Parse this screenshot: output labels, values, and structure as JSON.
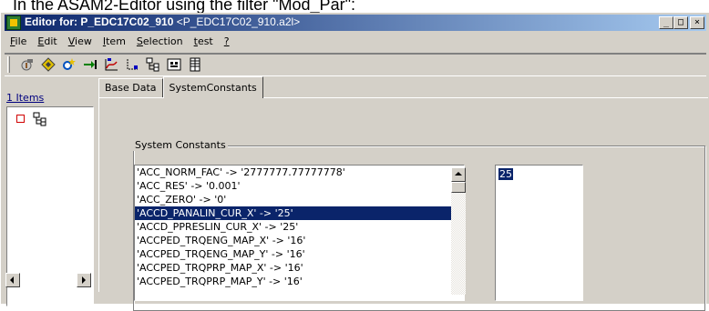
{
  "caption": "In the ASAM2-Editor using the filter \"Mod_Par\":",
  "window": {
    "title_main": "Editor for: P_EDC17C02_910",
    "title_suffix": "<P_EDC17C02_910.a2l>",
    "controls": {
      "minimize": "_",
      "maximize": "□",
      "close": "×"
    }
  },
  "menu": [
    {
      "ul": "F",
      "rest": "ile"
    },
    {
      "ul": "E",
      "rest": "dit"
    },
    {
      "ul": "V",
      "rest": "iew"
    },
    {
      "ul": "I",
      "rest": "tem"
    },
    {
      "ul": "S",
      "rest": "election"
    },
    {
      "ul": "t",
      "rest": "est"
    },
    {
      "ul": "?",
      "rest": ""
    }
  ],
  "toolbar": {
    "icons": [
      "hammer-icon",
      "diamond-tool-icon",
      "gear-star-icon",
      "arrow-bar-icon",
      "curve-chart-icon",
      "axis-icon",
      "tree-icon",
      "matrix-icon",
      "table-icon"
    ]
  },
  "left_pane": {
    "items_label": "1 Items"
  },
  "tabs": [
    {
      "label": "Base Data",
      "active": false
    },
    {
      "label": "SystemConstants",
      "active": true
    }
  ],
  "system_constants": {
    "group_label": "System Constants",
    "rows": [
      "'ACC_NORM_FAC' -> '2777777.77777778'",
      "'ACC_RES' -> '0.001'",
      "'ACC_ZERO' -> '0'",
      "'ACCD_PANALIN_CUR_X' -> '25'",
      "'ACCD_PPRESLIN_CUR_X' -> '25'",
      "'ACCPED_TRQENG_MAP_X' -> '16'",
      "'ACCPED_TRQENG_MAP_Y' -> '16'",
      "'ACCPED_TRQPRP_MAP_X' -> '16'",
      "'ACCPED_TRQPRP_MAP_Y' -> '16'"
    ],
    "selected_index": 3,
    "value": "25"
  },
  "colors": {
    "selection": "#0a246a",
    "title_start": "#0a246a",
    "title_end": "#a6caf0",
    "face": "#d4d0c8"
  }
}
